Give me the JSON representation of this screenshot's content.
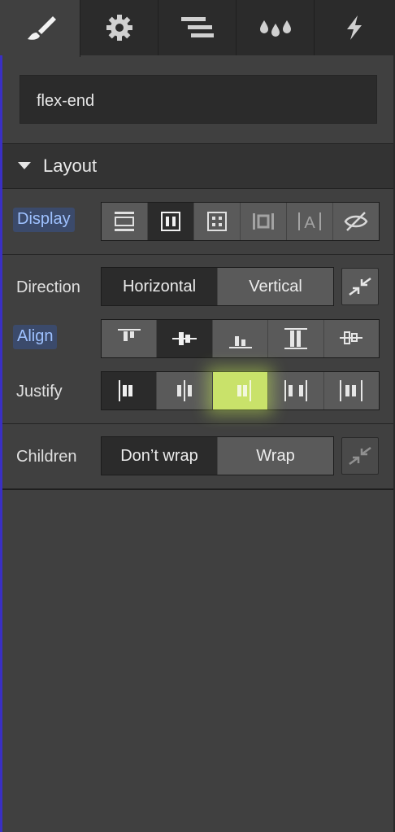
{
  "tabs": [
    {
      "icon": "brush-icon",
      "active": true
    },
    {
      "icon": "gear-icon",
      "active": false
    },
    {
      "icon": "navigator-icon",
      "active": false
    },
    {
      "icon": "drops-icon",
      "active": false
    },
    {
      "icon": "lightning-icon",
      "active": false
    }
  ],
  "selector": {
    "value": "flex-end"
  },
  "section": {
    "title": "Layout"
  },
  "display": {
    "label": "Display",
    "options": [
      "block-icon",
      "flex-icon",
      "grid-icon",
      "inline-block-icon",
      "inline-icon",
      "none-icon"
    ],
    "selected": "flex-icon"
  },
  "direction": {
    "label": "Direction",
    "options": [
      "Horizontal",
      "Vertical"
    ],
    "selected": "Horizontal"
  },
  "align": {
    "label": "Align",
    "options": [
      "align-start-icon",
      "align-center-icon",
      "align-end-icon",
      "align-stretch-icon",
      "align-baseline-icon"
    ],
    "selected": "align-center-icon"
  },
  "justify": {
    "label": "Justify",
    "options": [
      "justify-start-icon",
      "justify-center-icon",
      "justify-end-icon",
      "justify-space-between-icon",
      "justify-space-around-icon"
    ],
    "selected": "justify-start-icon",
    "hovered": "justify-end-icon"
  },
  "children": {
    "label": "Children",
    "options": [
      "Don’t wrap",
      "Wrap"
    ],
    "selected": "Don’t wrap"
  },
  "colors": {
    "accent_label_bg": "#3b4a6b",
    "accent_label_text": "#9ec1ff",
    "highlight": "#c9e26a"
  }
}
